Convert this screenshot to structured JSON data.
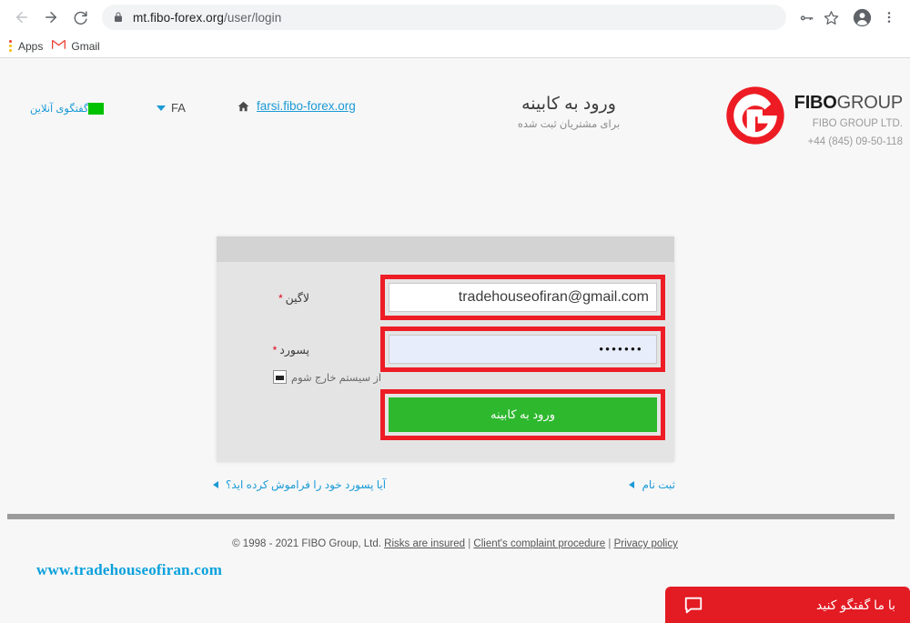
{
  "browser": {
    "back_label": "Back",
    "forward_label": "Forward",
    "reload_label": "Reload",
    "url_host": "mt.fibo-forex.org",
    "url_path": "/user/login",
    "lock_icon": "lock-icon",
    "key_icon": "key-icon",
    "star_icon": "star-icon",
    "avatar_icon": "account-icon",
    "menu_icon": "three-dot-menu-icon",
    "bookmarks": [
      {
        "label": "Apps",
        "icon": "apps-grid-icon"
      },
      {
        "label": "Gmail",
        "icon": "gmail-icon"
      }
    ]
  },
  "header": {
    "chat_online": "گفتگوی آنلاین",
    "language": "FA",
    "home_icon": "home-icon",
    "site_link": "farsi.fibo-forex.org",
    "title_main": "ورود به کابینه",
    "title_sub": "برای مشتریان ثبت شده",
    "brand_bold": "FIBO",
    "brand_light": "GROUP",
    "brand_company": "FIBO GROUP LTD.",
    "brand_phone": "+44 (845) 09-50-118",
    "brand_color": "#ed1c24"
  },
  "login_form": {
    "login_label": "لاگین",
    "login_value": "tradehouseofiran@gmail.com",
    "password_label": "پسورد",
    "password_value": "•••••••",
    "required_mark": "*",
    "remember_label": "از سیستم خارج شوم",
    "submit_label": "ورود به کابینه",
    "highlight_color": "#ee1c25",
    "submit_color": "#2eb82e"
  },
  "links": {
    "register": "ثبت نام",
    "forgot_password": "آیا پسورد خود را فراموش کرده اید؟"
  },
  "footer": {
    "copyright": "© 1998 - 2021 FIBO Group, Ltd.",
    "link_risks": "Risks are insured",
    "link_complaint": "Client's complaint procedure",
    "link_privacy": "Privacy policy",
    "separator": "|",
    "watermark_url": "www.tradehouseofiran.com"
  },
  "chat_widget": {
    "label": "با ما گفتگو کنید",
    "icon": "chat-bubble-icon",
    "color": "#e31b23"
  }
}
